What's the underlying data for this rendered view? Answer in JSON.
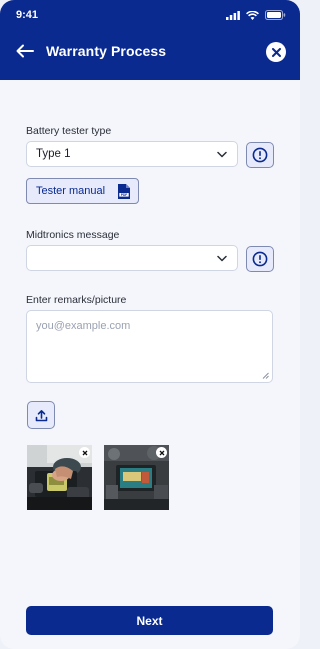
{
  "status_bar": {
    "time": "9:41"
  },
  "header": {
    "title": "Warranty Process"
  },
  "form": {
    "tester_type_label": "Battery tester type",
    "tester_type_value": "Type 1",
    "manual_button_label": "Tester manual",
    "midtronics_label": "Midtronics message",
    "midtronics_value": "",
    "remarks_label": "Enter remarks/picture",
    "remarks_placeholder": "you@example.com"
  },
  "attachments": [
    {
      "name": "battery-testing-photo"
    },
    {
      "name": "engine-bay-photo"
    }
  ],
  "footer": {
    "next_label": "Next"
  },
  "colors": {
    "primary": "#0a2a8f",
    "accent_bg": "#e6eafb",
    "page_bg": "#f4f6fb"
  },
  "icons": [
    "back-arrow-icon",
    "close-icon",
    "chevron-down-icon",
    "info-icon",
    "pdf-icon",
    "upload-icon",
    "remove-icon",
    "signal-icon",
    "wifi-icon",
    "battery-icon"
  ]
}
